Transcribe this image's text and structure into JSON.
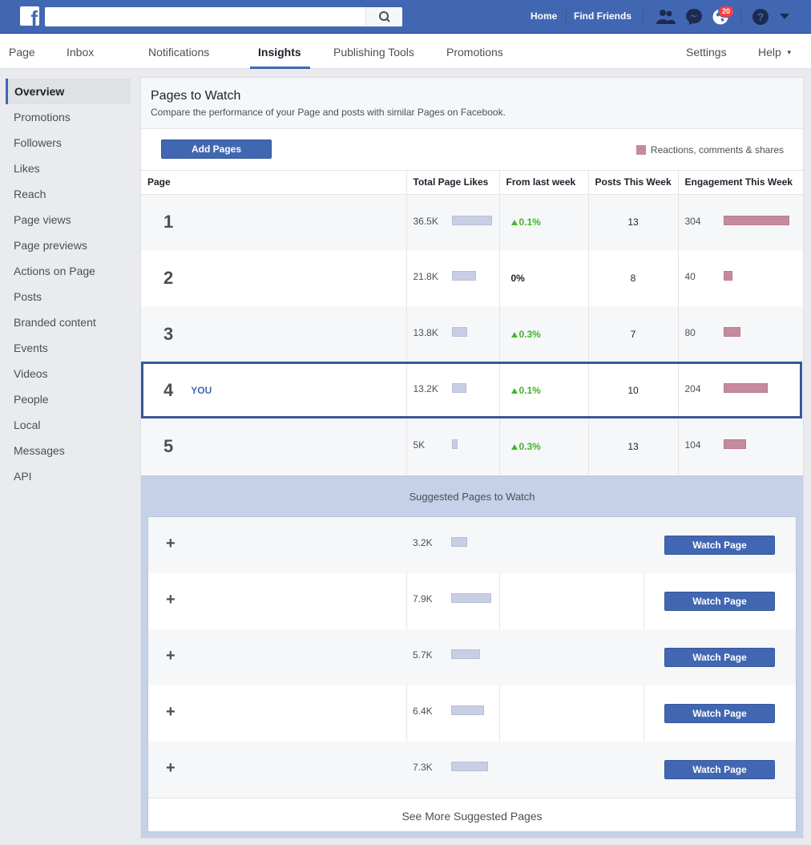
{
  "topbar": {
    "nav": {
      "home": "Home",
      "find_friends": "Find Friends"
    },
    "notification_count": "20",
    "icons": [
      "facebook-logo-icon",
      "search-icon",
      "friend-requests-icon",
      "messenger-icon",
      "notifications-globe-icon",
      "help-icon",
      "account-menu-arrow-icon"
    ]
  },
  "tabs": [
    {
      "label": "Page"
    },
    {
      "label": "Inbox"
    },
    {
      "label": "Notifications"
    },
    {
      "label": "Insights"
    },
    {
      "label": "Publishing Tools"
    },
    {
      "label": "Promotions"
    },
    {
      "label": "Settings"
    },
    {
      "label": "Help"
    }
  ],
  "active_tab": "Insights",
  "sidebar": {
    "items": [
      {
        "label": "Overview"
      },
      {
        "label": "Promotions"
      },
      {
        "label": "Followers"
      },
      {
        "label": "Likes"
      },
      {
        "label": "Reach"
      },
      {
        "label": "Page views"
      },
      {
        "label": "Page previews"
      },
      {
        "label": "Actions on Page"
      },
      {
        "label": "Posts"
      },
      {
        "label": "Branded content"
      },
      {
        "label": "Events"
      },
      {
        "label": "Videos"
      },
      {
        "label": "People"
      },
      {
        "label": "Local"
      },
      {
        "label": "Messages"
      },
      {
        "label": "API"
      }
    ],
    "active": "Overview"
  },
  "panel": {
    "title": "Pages to Watch",
    "subtitle": "Compare the performance of your Page and posts with similar Pages on Facebook.",
    "add_button": "Add Pages",
    "legend": "Reactions, comments & shares",
    "legend_color": "#c68a9f"
  },
  "table": {
    "headers": [
      "Page",
      "Total Page Likes",
      "From last week",
      "Posts This Week",
      "Engagement This Week"
    ],
    "rows": [
      {
        "rank": "1",
        "you": "",
        "likes": "36.5K",
        "likes_level": 1.0,
        "change": "0.1%",
        "change_up": true,
        "posts": "13",
        "engagement": "304",
        "engagement_level": 1.0
      },
      {
        "rank": "2",
        "you": "",
        "likes": "21.8K",
        "likes_level": 0.6,
        "change": "0%",
        "change_up": false,
        "posts": "8",
        "engagement": "40",
        "engagement_level": 0.13
      },
      {
        "rank": "3",
        "you": "",
        "likes": "13.8K",
        "likes_level": 0.38,
        "change": "0.3%",
        "change_up": true,
        "posts": "7",
        "engagement": "80",
        "engagement_level": 0.26
      },
      {
        "rank": "4",
        "you": "YOU",
        "likes": "13.2K",
        "likes_level": 0.36,
        "change": "0.1%",
        "change_up": true,
        "posts": "10",
        "engagement": "204",
        "engagement_level": 0.67
      },
      {
        "rank": "5",
        "you": "",
        "likes": "5K",
        "likes_level": 0.14,
        "change": "0.3%",
        "change_up": true,
        "posts": "13",
        "engagement": "104",
        "engagement_level": 0.34
      }
    ]
  },
  "suggested": {
    "title": "Suggested Pages to Watch",
    "watch_label": "Watch Page",
    "see_more": "See More Suggested Pages",
    "rows": [
      {
        "likes": "3.2K",
        "likes_level": 0.4
      },
      {
        "likes": "7.9K",
        "likes_level": 1.0
      },
      {
        "likes": "5.7K",
        "likes_level": 0.72
      },
      {
        "likes": "6.4K",
        "likes_level": 0.81
      },
      {
        "likes": "7.3K",
        "likes_level": 0.92
      }
    ]
  }
}
